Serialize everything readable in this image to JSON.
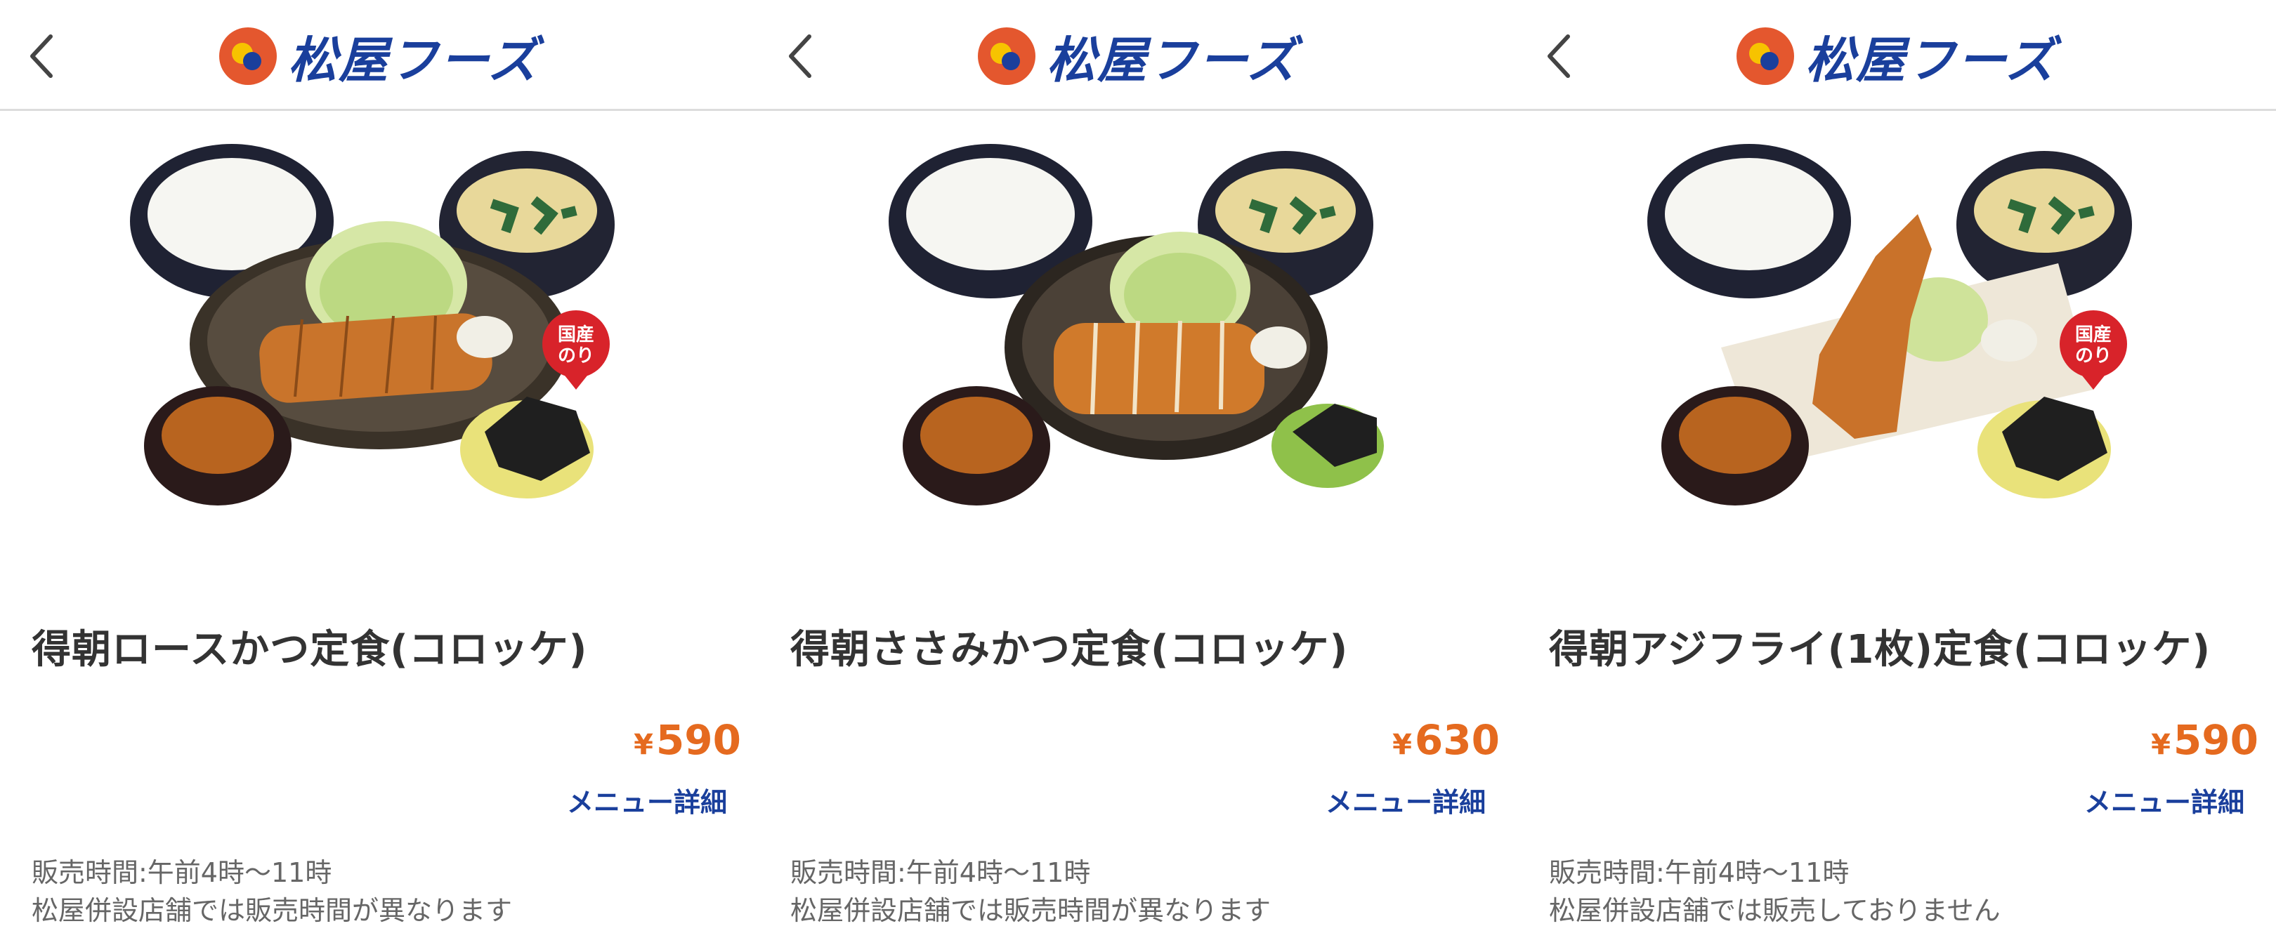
{
  "brand": {
    "logo_text": "松屋フーズ",
    "colors": {
      "primary": "#1a3f9c",
      "logo_orange": "#e4572e",
      "logo_yellow": "#f7c300",
      "price": "#e56a1f"
    }
  },
  "screens": [
    {
      "header": {
        "back_icon": "chevron-left-icon"
      },
      "item": {
        "name": "得朝ロースかつ定食(コロッケ)",
        "currency": "¥",
        "price": "590",
        "detail_link": "メニュー詳細",
        "sales_hours": "販売時間:午前4時〜11時",
        "store_note": "松屋併設店舗では販売時間が異なります",
        "badge": "国産のり"
      }
    },
    {
      "header": {
        "back_icon": "chevron-left-icon"
      },
      "item": {
        "name": "得朝ささみかつ定食(コロッケ)",
        "currency": "¥",
        "price": "630",
        "detail_link": "メニュー詳細",
        "sales_hours": "販売時間:午前4時〜11時",
        "store_note": "松屋併設店舗では販売時間が異なります"
      }
    },
    {
      "header": {
        "back_icon": "chevron-left-icon"
      },
      "item": {
        "name": "得朝アジフライ(1枚)定食(コロッケ)",
        "currency": "¥",
        "price": "590",
        "detail_link": "メニュー詳細",
        "sales_hours": "販売時間:午前4時〜11時",
        "store_note": "松屋併設店舗では販売しておりません",
        "badge": "国産のり"
      }
    }
  ]
}
